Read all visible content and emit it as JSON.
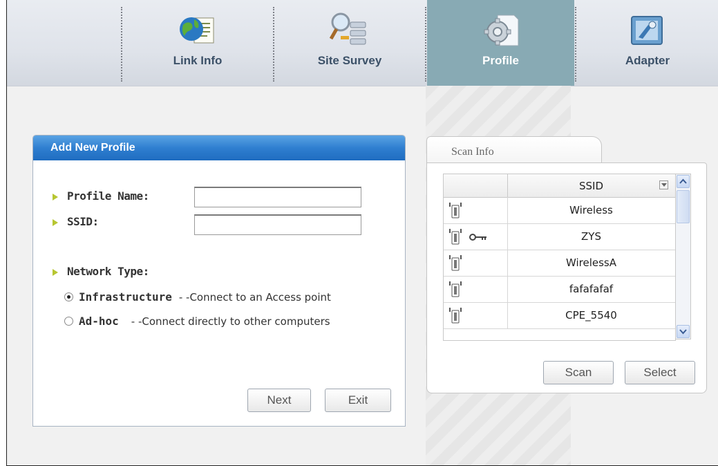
{
  "toolbar": {
    "items": [
      {
        "label": "Link Info",
        "icon": "globe-document-icon",
        "active": false
      },
      {
        "label": "Site Survey",
        "icon": "magnifier-network-icon",
        "active": false
      },
      {
        "label": "Profile",
        "icon": "gear-document-icon",
        "active": true
      },
      {
        "label": "Adapter",
        "icon": "adapter-icon",
        "active": false
      }
    ]
  },
  "add_profile": {
    "title": "Add New Profile",
    "profile_name_label": "Profile Name:",
    "profile_name_value": "",
    "ssid_label": "SSID:",
    "ssid_value": "",
    "network_type_label": "Network Type:",
    "options": [
      {
        "label": "Infrastructure",
        "desc": "- -Connect to an Access point",
        "selected": true
      },
      {
        "label": "Ad-hoc",
        "desc": "- -Connect directly to other computers",
        "selected": false
      }
    ],
    "next_label": "Next",
    "exit_label": "Exit"
  },
  "scan_info": {
    "tab_label": "Scan Info",
    "column_ssid": "SSID",
    "rows": [
      {
        "ssid": "Wireless",
        "secured": false
      },
      {
        "ssid": "ZYS",
        "secured": true
      },
      {
        "ssid": "WirelessA",
        "secured": false
      },
      {
        "ssid": "fafafafaf",
        "secured": false
      },
      {
        "ssid": "CPE_5540",
        "secured": false
      }
    ],
    "scan_label": "Scan",
    "select_label": "Select"
  },
  "colors": {
    "panel_header": "#2f7fd0",
    "active_tab": "#88aab4",
    "bullet": "#b7c631"
  }
}
